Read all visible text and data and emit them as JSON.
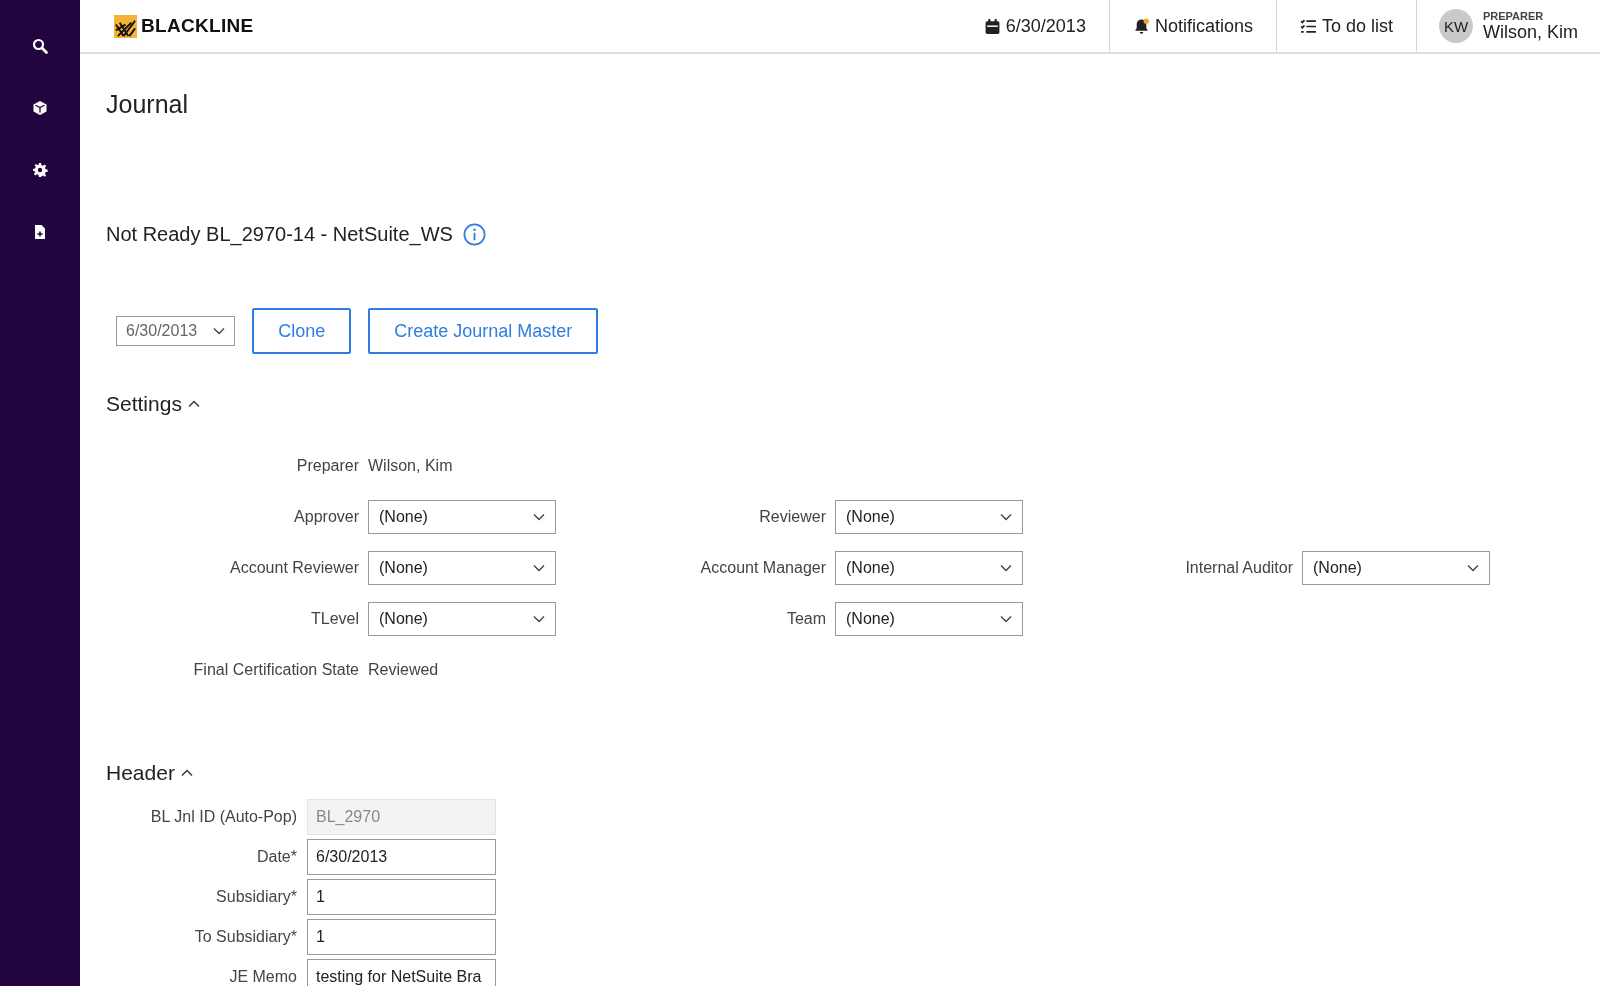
{
  "topbar": {
    "logo": "BLACKLINE",
    "date": "6/30/2013",
    "notifications": {
      "label": "Notifications",
      "unread": true
    },
    "todo": "To do list",
    "user": {
      "initials": "KW",
      "role": "PREPARER",
      "name": "Wilson, Kim"
    }
  },
  "sidebar": {
    "items": [
      {
        "kind": "search"
      },
      {
        "kind": "cube"
      },
      {
        "kind": "gear"
      },
      {
        "kind": "file"
      }
    ]
  },
  "page_title": "Journal",
  "subtitle": "Not Ready BL_2970-14 - NetSuite_WS",
  "toolbar": {
    "period": "6/30/2013",
    "buttons": [
      "Clone",
      "Create Journal Master"
    ]
  },
  "settings": {
    "title": "Settings",
    "expanded": true,
    "rows": [
      [
        {
          "label": "Preparer",
          "value": "Wilson, Kim",
          "kind": "text"
        }
      ],
      [
        {
          "label": "Approver",
          "value": "(None)",
          "kind": "select"
        },
        {
          "label": "Reviewer",
          "value": "(None)",
          "kind": "select"
        }
      ],
      [
        {
          "label": "Account Reviewer",
          "value": "(None)",
          "kind": "select"
        },
        {
          "label": "Account Manager",
          "value": "(None)",
          "kind": "select"
        },
        {
          "label": "Internal Auditor",
          "value": "(None)",
          "kind": "select"
        }
      ],
      [
        {
          "label": "TLevel",
          "value": "(None)",
          "kind": "select"
        },
        {
          "label": "Team",
          "value": "(None)",
          "kind": "select"
        }
      ],
      [
        {
          "label": "Final Certification State",
          "value": "Reviewed",
          "kind": "text"
        }
      ]
    ]
  },
  "header": {
    "title": "Header",
    "expanded": true,
    "fields": [
      {
        "label": "BL Jnl ID (Auto-Pop)",
        "value": "BL_2970",
        "disabled": true
      },
      {
        "label": "Date*",
        "value": "6/30/2013",
        "disabled": false
      },
      {
        "label": "Subsidiary*",
        "value": "1",
        "disabled": false
      },
      {
        "label": "To Subsidiary*",
        "value": "1",
        "disabled": false
      },
      {
        "label": "JE Memo",
        "value": "testing for NetSuite Bra",
        "disabled": false
      }
    ]
  }
}
